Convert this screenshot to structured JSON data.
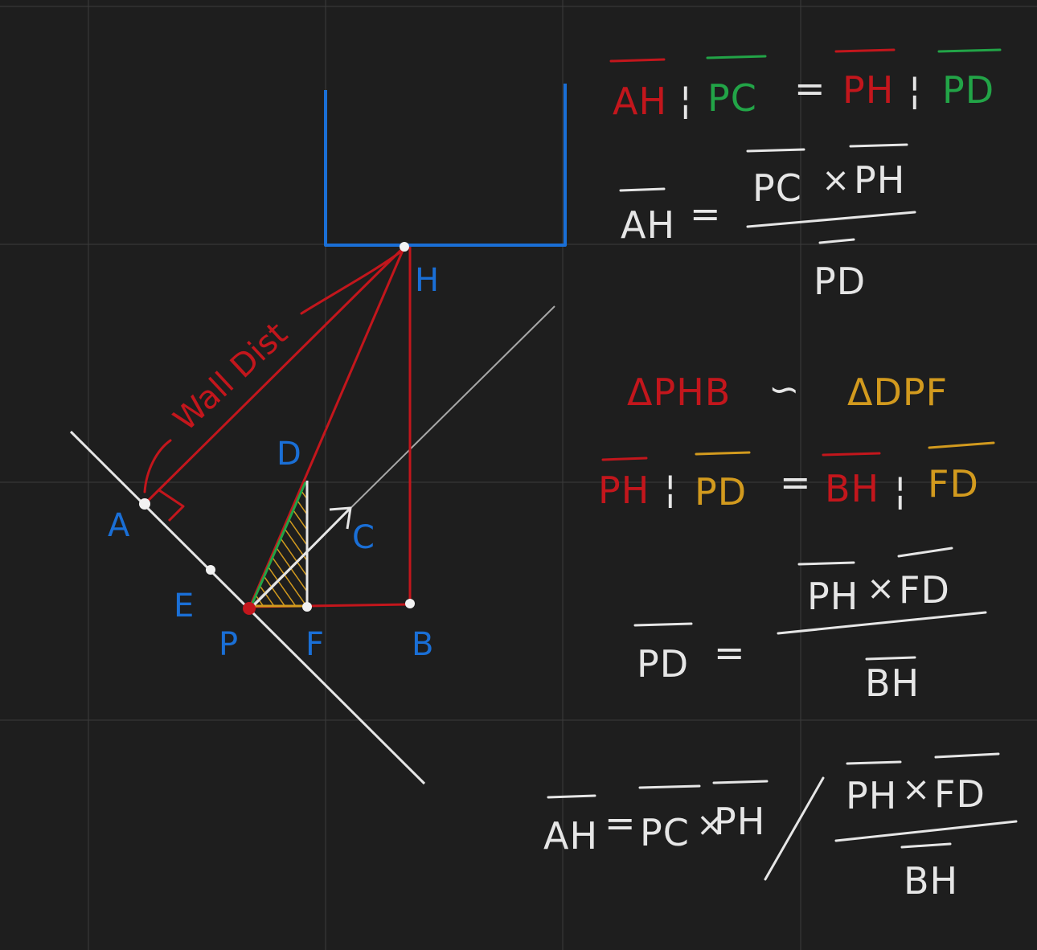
{
  "colors": {
    "background": "#1e1e1e",
    "grid": "#3c3c3c",
    "chalk_white": "#e6e6e6",
    "blue": "#1a6fd6",
    "red": "#c3161c",
    "green": "#22a447",
    "amber": "#d29a1e"
  },
  "labels": {
    "H": "H",
    "A": "A",
    "D": "D",
    "C": "C",
    "E": "E",
    "P": "P",
    "F": "F",
    "B": "B",
    "wall_dist": "Wall Dist"
  },
  "equations": {
    "eq1": {
      "t1": "AH",
      "sep1": "¦",
      "t2": "PC",
      "eq": "=",
      "t3": "PH",
      "sep2": "¦",
      "t4": "PD"
    },
    "eq2": {
      "lhs": "AH",
      "eq": "=",
      "num_a": "PC",
      "times": "×",
      "num_b": "PH",
      "den": "PD"
    },
    "eq3": {
      "left": "ΔPHB",
      "similar": "∽",
      "right": "ΔDPF"
    },
    "eq4": {
      "t1": "PH",
      "sep1": "¦",
      "t2": "PD",
      "eq": "=",
      "t3": "BH",
      "sep2": "¦",
      "t4": "FD"
    },
    "eq5": {
      "lhs": "PD",
      "eq": "=",
      "num_a": "PH",
      "times": "×",
      "num_b": "FD",
      "den": "BH"
    },
    "eq6": {
      "lhs": "AH",
      "eq": "=",
      "a": "PC",
      "times1": "×",
      "b": "PH",
      "slash": "/",
      "num_a": "PH",
      "times2": "×",
      "num_b": "FD",
      "den": "BH"
    }
  }
}
